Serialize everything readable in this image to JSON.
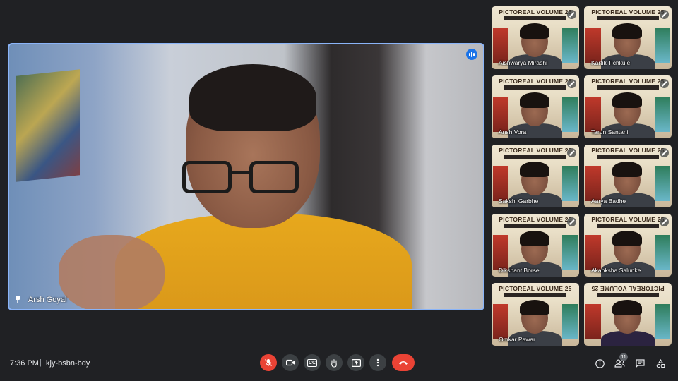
{
  "main": {
    "speaker_name": "Arsh Goyal"
  },
  "participants": [
    {
      "name": "Aishwarya Mirashi",
      "banner": "PICTOREAL VOLUME 25",
      "subbanner": "CELEBRATING 25 VOLUMES OF EXCELLENCE",
      "muted": true
    },
    {
      "name": "Kartik Tichkule",
      "banner": "PICTOREAL VOLUME 25",
      "subbanner": "CELEBRATING 25 VOLUMES OF EXCELLENCE",
      "muted": true
    },
    {
      "name": "Ansh Vora",
      "banner": "PICTOREAL VOLUME 25",
      "subbanner": "CELEBRATING 25 VOLUMES OF EXCELLENCE",
      "muted": true
    },
    {
      "name": "Tarun Santani",
      "banner": "PICTOREAL VOLUME 25",
      "subbanner": "CELEBRATING 25 VOLUMES OF EXCELLENCE",
      "muted": true
    },
    {
      "name": "Sakshi Garbhe",
      "banner": "PICTOREAL VOLUME 25",
      "subbanner": "CELEBRATING 25 VOLUMES OF EXCELLENCE",
      "muted": true
    },
    {
      "name": "Aarya Badhe",
      "banner": "PICTOREAL VOLUME 25",
      "subbanner": "CELEBRATING 25 VOLUMES OF EXCELLENCE",
      "muted": true
    },
    {
      "name": "Dikshant Borse",
      "banner": "PICTOREAL VOLUME 25",
      "subbanner": "CELEBRATING 25 VOLUMES OF EXCELLENCE",
      "muted": true
    },
    {
      "name": "Akanksha Salunke",
      "banner": "PICTOREAL VOLUME 25",
      "subbanner": "CELEBRATING 25 VOLUMES OF EXCELLENCE",
      "muted": true
    },
    {
      "name": "Omkar Pawar",
      "banner": "PICTOREAL VOLUME 25",
      "subbanner": "CELEBRATING 25 VOLUMES OF EXCELLENCE",
      "muted": false
    },
    {
      "name": "",
      "banner": "PICTOREAL VOLUME 25",
      "subbanner": "CELEBRATING 25 VOLUMES OF EXCELLENCE",
      "muted": false
    }
  ],
  "bottom_bar": {
    "time": "7:36 PM",
    "separator": "|",
    "meeting_code": "kjy-bsbn-bdy",
    "controls": {
      "mic_icon": "mic-off-icon",
      "camera_icon": "videocam-icon",
      "captions_icon": "closed-captions-icon",
      "captions_label": "CC",
      "hand_icon": "raise-hand-icon",
      "present_icon": "present-screen-icon",
      "more_icon": "more-options-icon",
      "end_icon": "call-end-icon"
    },
    "right": {
      "info_icon": "info-icon",
      "people_icon": "people-icon",
      "people_count": "11",
      "chat_icon": "chat-icon",
      "activities_icon": "activities-icon"
    }
  },
  "colors": {
    "background": "#202124",
    "accent_border": "#8ab4f8",
    "end_call": "#ea4335",
    "speaking_indicator": "#1a73e8"
  }
}
